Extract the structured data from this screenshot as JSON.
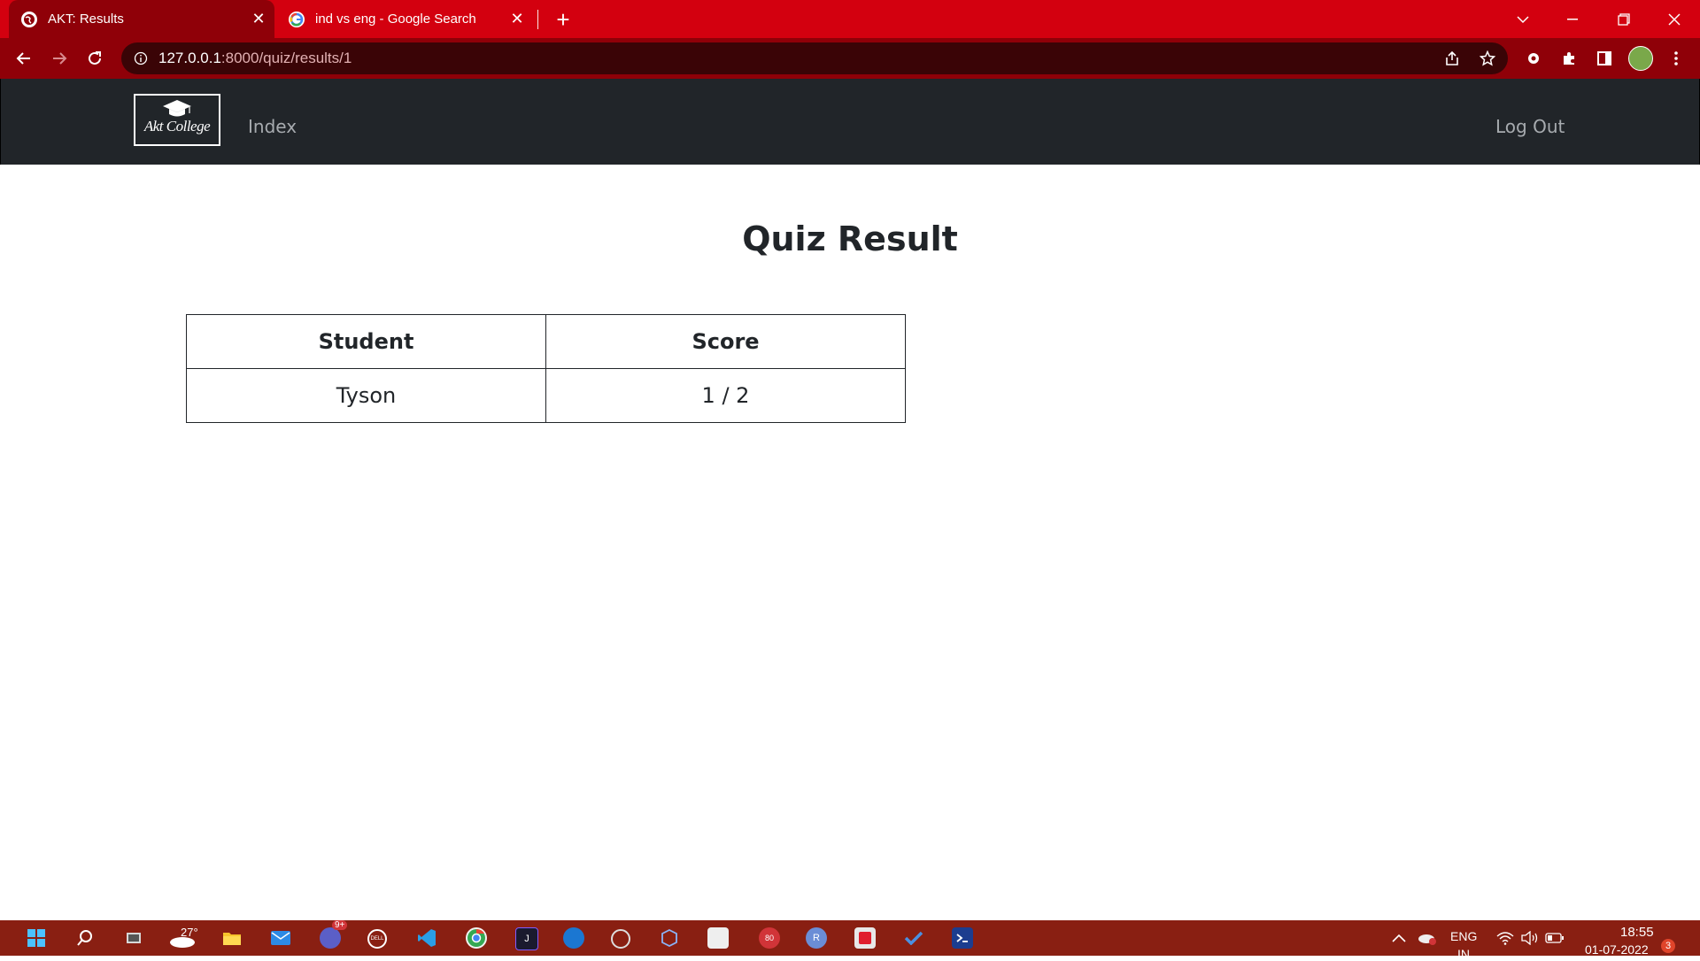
{
  "browser": {
    "tabs": [
      {
        "title": "AKT: Results",
        "active": true
      },
      {
        "title": "ind vs eng - Google Search",
        "active": false
      }
    ],
    "url_host": "127.0.0.1",
    "url_rest": ":8000/quiz/results/1"
  },
  "navbar": {
    "logo_text": "Akt College",
    "index_link": "Index",
    "logout_link": "Log Out"
  },
  "page": {
    "title": "Quiz Result",
    "table": {
      "headers": [
        "Student",
        "Score"
      ],
      "rows": [
        [
          "Tyson",
          "1 / 2"
        ]
      ]
    }
  },
  "taskbar": {
    "weather_temp": "27°",
    "language": "ENG",
    "language_sub": "IN",
    "time": "18:55",
    "date": "01-07-2022",
    "notification_count": "3",
    "chat_badge": "9+",
    "app_badge": "80"
  },
  "colors": {
    "tabstrip": "#d3000f",
    "toolbar": "#8f0008",
    "navbar": "#212529",
    "taskbar": "#891f12"
  }
}
